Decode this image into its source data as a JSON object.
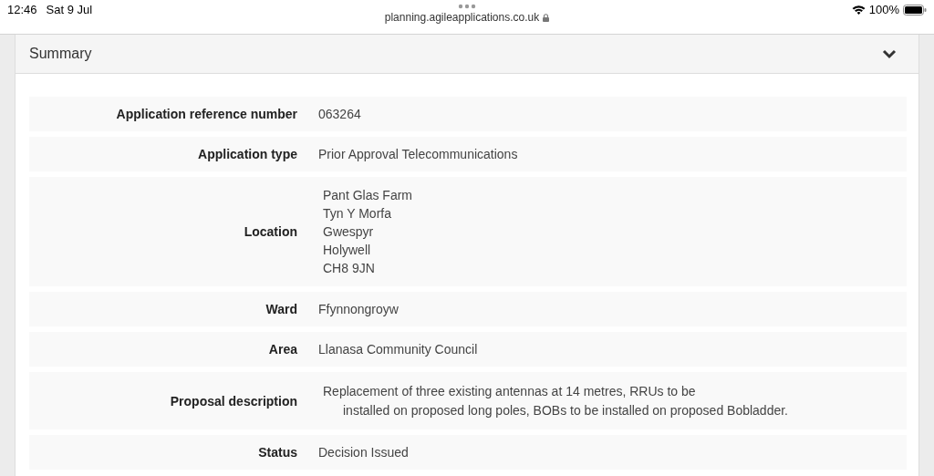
{
  "status_bar": {
    "time": "12:46",
    "date": "Sat 9 Jul",
    "url": "planning.agileapplications.co.uk",
    "battery": "100%"
  },
  "panel": {
    "title": "Summary",
    "expanded": true
  },
  "rows": [
    {
      "kind": "text",
      "label": "Application reference number",
      "value": "063264"
    },
    {
      "kind": "text",
      "label": "Application type",
      "value": "Prior Approval Telecommunications"
    },
    {
      "kind": "address",
      "label": "Location",
      "lines": [
        "Pant Glas Farm",
        "Tyn Y Morfa",
        "Gwespyr",
        "Holywell",
        "CH8 9JN"
      ]
    },
    {
      "kind": "text",
      "label": "Ward",
      "value": "Ffynnongroyw"
    },
    {
      "kind": "text",
      "label": "Area",
      "value": "Llanasa Community Council"
    },
    {
      "kind": "hanging",
      "label": "Proposal description",
      "lines": [
        "Replacement of three existing antennas at 14 metres, RRUs to be",
        "installed on proposed long poles, BOBs to be installed on proposed Bobladder."
      ]
    },
    {
      "kind": "text",
      "label": "Status",
      "value": "Decision Issued"
    }
  ]
}
